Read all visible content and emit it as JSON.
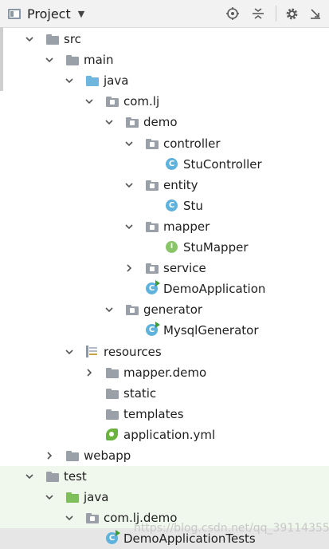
{
  "toolbar": {
    "title": "Project",
    "dropdown_icon": "caret-down-icon",
    "buttons": [
      "locate-icon",
      "collapse-all-icon",
      "gear-icon",
      "hide-icon"
    ]
  },
  "colors": {
    "folder": "#9aa0a7",
    "source_folder": "#6fb6dd",
    "test_folder": "#7fbf5a",
    "class_icon": "#5fb2dc",
    "interface_icon": "#8bc56a",
    "test_row_highlight": "#f0f7ec"
  },
  "tree": [
    {
      "label": "src",
      "state": "expanded",
      "icon": "folder-icon"
    },
    {
      "label": "main",
      "state": "expanded",
      "icon": "folder-icon"
    },
    {
      "label": "java",
      "state": "expanded",
      "icon": "source-folder-icon"
    },
    {
      "label": "com.lj",
      "state": "expanded",
      "icon": "package-icon"
    },
    {
      "label": "demo",
      "state": "expanded",
      "icon": "package-icon"
    },
    {
      "label": "controller",
      "state": "expanded",
      "icon": "package-icon"
    },
    {
      "label": "StuController",
      "state": "leaf",
      "icon": "class-icon",
      "glyph": "C"
    },
    {
      "label": "entity",
      "state": "expanded",
      "icon": "package-icon"
    },
    {
      "label": "Stu",
      "state": "leaf",
      "icon": "class-icon",
      "glyph": "C"
    },
    {
      "label": "mapper",
      "state": "expanded",
      "icon": "package-icon"
    },
    {
      "label": "StuMapper",
      "state": "leaf",
      "icon": "interface-icon",
      "glyph": "I"
    },
    {
      "label": "service",
      "state": "collapsed",
      "icon": "package-icon"
    },
    {
      "label": "DemoApplication",
      "state": "leaf",
      "icon": "runnable-class-icon",
      "glyph": "C"
    },
    {
      "label": "generator",
      "state": "expanded",
      "icon": "package-icon"
    },
    {
      "label": "MysqlGenerator",
      "state": "leaf",
      "icon": "runnable-class-icon",
      "glyph": "C"
    },
    {
      "label": "resources",
      "state": "expanded",
      "icon": "resources-folder-icon"
    },
    {
      "label": "mapper.demo",
      "state": "collapsed",
      "icon": "folder-icon"
    },
    {
      "label": "static",
      "state": "leaf",
      "icon": "folder-icon"
    },
    {
      "label": "templates",
      "state": "leaf",
      "icon": "folder-icon"
    },
    {
      "label": "application.yml",
      "state": "leaf",
      "icon": "yml-file-icon"
    },
    {
      "label": "webapp",
      "state": "collapsed",
      "icon": "folder-icon"
    },
    {
      "label": "test",
      "state": "expanded",
      "icon": "folder-icon"
    },
    {
      "label": "java",
      "state": "expanded",
      "icon": "test-source-folder-icon"
    },
    {
      "label": "com.lj.demo",
      "state": "expanded",
      "icon": "package-icon"
    },
    {
      "label": "DemoApplicationTests",
      "state": "leaf",
      "icon": "test-class-icon",
      "glyph": "C"
    }
  ],
  "watermark": "https://blog.csdn.net/qq_39114355"
}
